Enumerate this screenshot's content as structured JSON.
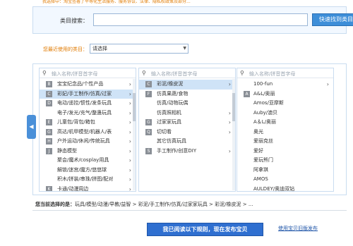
{
  "notice": "我选择中：淘宝签署了平等化生活服务、服务协议、法律、隐私权政策及部分...",
  "search": {
    "label": "类目搜索：",
    "placeholder": "",
    "button": "快速找到类目"
  },
  "recent": {
    "label": "您最近使用的类目：",
    "value": "请选择"
  },
  "columns": [
    {
      "placeholder": "输入名称/拼音首字母",
      "items": [
        {
          "key": "B",
          "label": "宝宝纪念品/个性产品",
          "has_children": true,
          "selected": false
        },
        {
          "key": "C",
          "label": "彩妃/手工制作/仿真/过家",
          "has_children": true,
          "selected": true
        },
        {
          "key": "D",
          "label": "电动/遥控/惯性/发条玩具",
          "has_children": true,
          "selected": false
        },
        {
          "key": "",
          "label": "电子/发光/充气/整蛊玩具",
          "has_children": true,
          "selected": false
        },
        {
          "key": "E",
          "label": "儿童包/背包/箱包",
          "has_children": true,
          "selected": false
        },
        {
          "key": "G",
          "label": "高达/机甲模型/机器人/表",
          "has_children": true,
          "selected": false
        },
        {
          "key": "H",
          "label": "户外运动/休闲/传统玩具",
          "has_children": true,
          "selected": false
        },
        {
          "key": "J",
          "label": "静态模型",
          "has_children": true,
          "selected": false
        },
        {
          "key": "",
          "label": "聚会/魔术/cosplay用具",
          "has_children": true,
          "selected": false
        },
        {
          "key": "",
          "label": "解锁/迷宫/魔方/悠悠球",
          "has_children": true,
          "selected": false
        },
        {
          "key": "",
          "label": "积木/拼装/串珠/拼图/配对",
          "has_children": true,
          "selected": false
        },
        {
          "key": "K",
          "label": "卡通/动漫周边",
          "has_children": true,
          "selected": false
        }
      ]
    },
    {
      "placeholder": "输入名称/拼音首字母",
      "items": [
        {
          "key": "C",
          "label": "彩泥/橡皮泥",
          "has_children": true,
          "selected": true
        },
        {
          "key": "F",
          "label": "仿真果蔬/食物",
          "has_children": false,
          "selected": false
        },
        {
          "key": "",
          "label": "仿真/动物玩偶",
          "has_children": false,
          "selected": false
        },
        {
          "key": "",
          "label": "仿真照相机",
          "has_children": true,
          "selected": false
        },
        {
          "key": "G",
          "label": "过家家玩具",
          "has_children": true,
          "selected": false
        },
        {
          "key": "Q",
          "label": "切切看",
          "has_children": true,
          "selected": false
        },
        {
          "key": "",
          "label": "其它仿真玩具",
          "has_children": false,
          "selected": false
        },
        {
          "key": "S",
          "label": "手工制作/创意DIY",
          "has_children": true,
          "selected": false
        }
      ]
    },
    {
      "placeholder": "输入名称/拼音首字母",
      "items": [
        {
          "key": "",
          "label": "100-fun",
          "has_children": true,
          "selected": false
        },
        {
          "key": "A",
          "label": "A&L/奥丽",
          "has_children": false,
          "selected": false
        },
        {
          "key": "",
          "label": "Amos/亚摩斯",
          "has_children": false,
          "selected": false
        },
        {
          "key": "",
          "label": "Auby/澳贝",
          "has_children": false,
          "selected": false
        },
        {
          "key": "",
          "label": "A＆L/奥丽",
          "has_children": false,
          "selected": false
        },
        {
          "key": "",
          "label": "奥光",
          "has_children": false,
          "selected": false
        },
        {
          "key": "",
          "label": "爱丽克丝",
          "has_children": false,
          "selected": false
        },
        {
          "key": "",
          "label": "爱好",
          "has_children": false,
          "selected": false
        },
        {
          "key": "",
          "label": "爱玩熊门",
          "has_children": false,
          "selected": false
        },
        {
          "key": "",
          "label": "阿拿琪",
          "has_children": false,
          "selected": false
        },
        {
          "key": "",
          "label": "AMOS",
          "has_children": false,
          "selected": false
        },
        {
          "key": "",
          "label": "AULDEY/奥迪双钻",
          "has_children": false,
          "selected": false
        }
      ]
    }
  ],
  "breadcrumb": {
    "label": "您当前选择的是：",
    "path": "玩具/模型/动漫/早教/益智 > 彩泥/手工制作/仿真/过家家玩具 > 彩泥/橡皮泥 > ..."
  },
  "publish_button": "我已阅读以下规则，现在发布宝贝",
  "old_link": "使用宝贝旧版发布",
  "colors": {
    "accent": "#2f6fd0",
    "panel_border": "#c9dcf0",
    "selected_bg": "#cfe3f7",
    "warning": "#e07a00"
  }
}
